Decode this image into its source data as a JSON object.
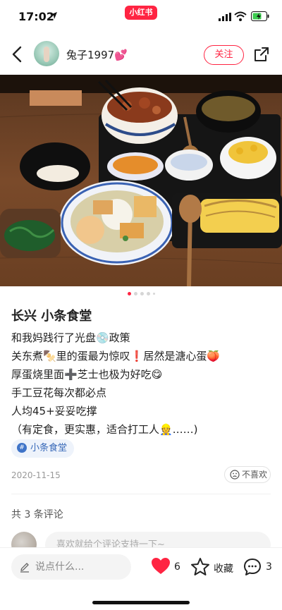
{
  "status_bar": {
    "time": "17:02",
    "app_badge": "小红书"
  },
  "header": {
    "username": "兔子1997💕",
    "follow_label": "关注"
  },
  "carousel": {
    "count": 5,
    "active_index": 0
  },
  "note": {
    "title": "长兴 小条食堂",
    "lines": [
      "和我妈践行了光盘💿政策",
      "关东煮🍢里的蛋最为惊叹❗️居然是溏心蛋🍑",
      "厚蛋烧里面➕芝士也极为好吃😋",
      "手工豆花每次都必点",
      "人均45+妥妥吃撑",
      "（有定食，更实惠，适合打工人👷……)"
    ],
    "tag": "小条食堂",
    "date": "2020-11-15",
    "dislike_label": "不喜欢"
  },
  "comments": {
    "count_label": "共 3 条评论",
    "input_placeholder": "喜欢就给个评论支持一下~"
  },
  "bottom_bar": {
    "say_placeholder": "说点什么...",
    "like_count": "6",
    "collect_label": "收藏",
    "comment_count": "3"
  },
  "colors": {
    "brand": "#ff2442",
    "tag_blue": "#3768b8",
    "like_red": "#ff2442"
  }
}
